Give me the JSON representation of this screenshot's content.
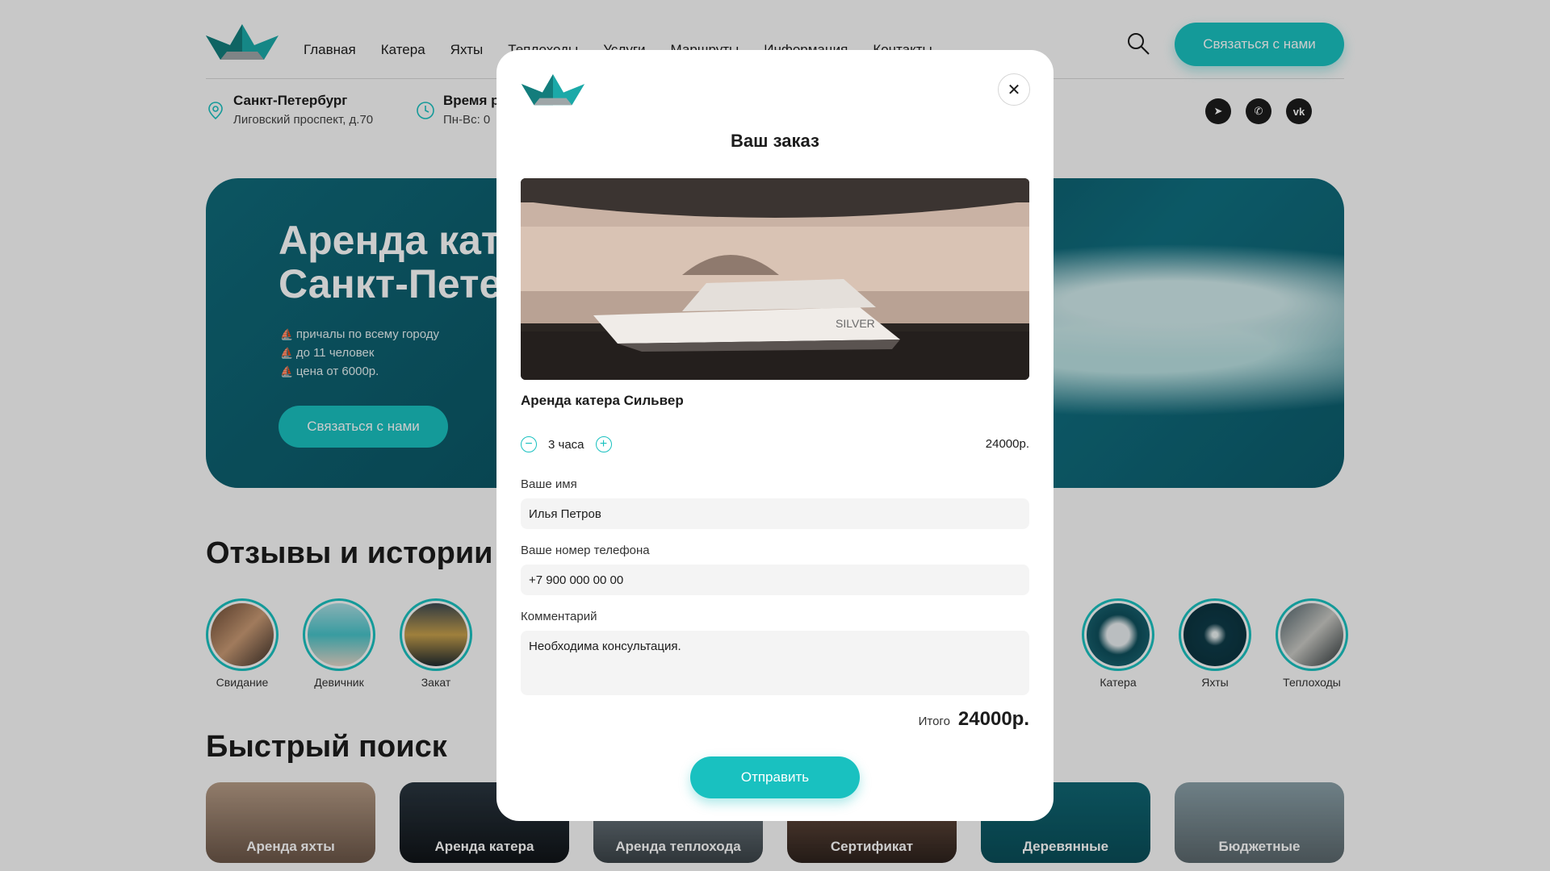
{
  "colors": {
    "accent": "#19c1c0",
    "text": "#1c1c1c",
    "overlay": "rgba(0,0,0,0.2)"
  },
  "header": {
    "nav": [
      "Главная",
      "Катера",
      "Яхты",
      "Теплоходы",
      "Услуги",
      "Маршруты",
      "Информация",
      "Контакты"
    ],
    "cta_label": "Связаться с нами",
    "search_icon": "search-icon"
  },
  "infobar": {
    "location_title": "Санкт-Петербург",
    "location_address": "Лиговский проспект, д.70",
    "hours_title": "Время р",
    "hours_value": "Пн-Вс: 0",
    "socials": [
      "telegram-icon",
      "whatsapp-icon",
      "vk-icon"
    ]
  },
  "hero": {
    "title_line1": "Аренда кат",
    "title_line2": "Санкт-Пете",
    "features": [
      "причалы по всему городу",
      "до 11 человек",
      "цена от 6000р."
    ],
    "cta_label": "Связаться с нами"
  },
  "stories": {
    "heading": "Отзывы и истории",
    "items": [
      "Свидание",
      "Девичник",
      "Закат",
      "",
      "Катера",
      "Яхты",
      "Теплоходы"
    ]
  },
  "quick_search": {
    "heading": "Быстрый поиск",
    "cards": [
      "Аренда яхты",
      "Аренда катера",
      "Аренда теплохода",
      "Сертификат",
      "Деревянные",
      "Бюджетные"
    ]
  },
  "modal": {
    "title": "Ваш заказ",
    "product_name": "Аренда катера Сильвер",
    "duration_value": "3 часа",
    "line_price": "24000р.",
    "name_label": "Ваше имя",
    "name_value": "Илья Петров",
    "phone_label": "Ваше номер телефона",
    "phone_value": "+7 900 000 00 00",
    "comment_label": "Комментарий",
    "comment_value": "Необходима консультация.",
    "total_label": "Итого",
    "total_value": "24000р.",
    "submit_label": "Отправить"
  }
}
